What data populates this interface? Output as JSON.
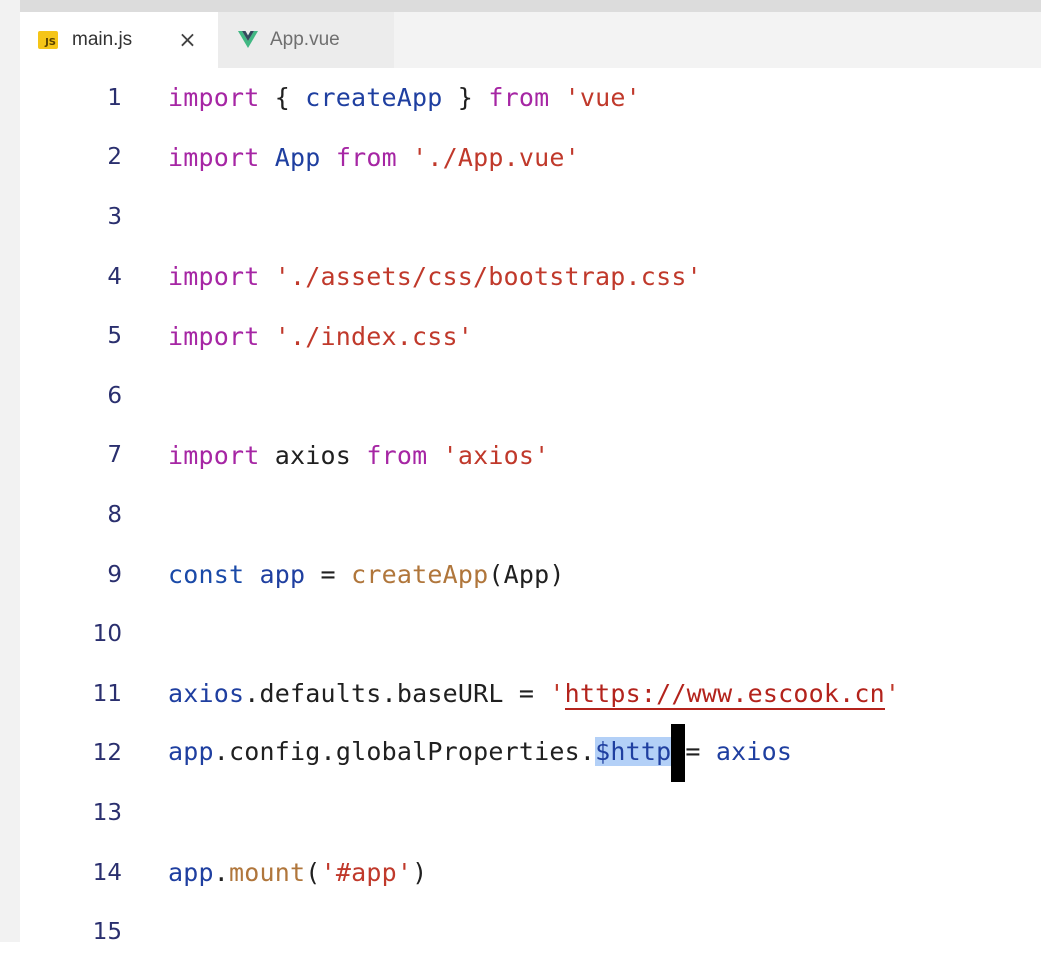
{
  "tabs": [
    {
      "label": "main.js",
      "icon": "js-file-icon",
      "icon_text": "JS",
      "active": true
    },
    {
      "label": "App.vue",
      "icon": "vue-file-icon",
      "active": false
    }
  ],
  "close_glyph": "×",
  "lines": [
    {
      "n": "1"
    },
    {
      "n": "2"
    },
    {
      "n": "3"
    },
    {
      "n": "4"
    },
    {
      "n": "5"
    },
    {
      "n": "6"
    },
    {
      "n": "7"
    },
    {
      "n": "8"
    },
    {
      "n": "9"
    },
    {
      "n": "10"
    },
    {
      "n": "11"
    },
    {
      "n": "12"
    },
    {
      "n": "13"
    },
    {
      "n": "14"
    },
    {
      "n": "15"
    }
  ],
  "code": {
    "l1": {
      "import": "import",
      "open": " { ",
      "name": "createApp",
      "close": " } ",
      "from": "from",
      "sp": " ",
      "src": "'vue'"
    },
    "l2": {
      "import": "import",
      "sp1": " ",
      "name": "App",
      "sp2": " ",
      "from": "from",
      "sp3": " ",
      "src": "'./App.vue'"
    },
    "l4": {
      "import": "import",
      "sp": " ",
      "src": "'./assets/css/bootstrap.css'"
    },
    "l5": {
      "import": "import",
      "sp": " ",
      "src": "'./index.css'"
    },
    "l7": {
      "import": "import",
      "sp1": " ",
      "name": "axios",
      "sp2": " ",
      "from": "from",
      "sp3": " ",
      "src": "'axios'"
    },
    "l9": {
      "const": "const",
      "sp1": " ",
      "name": "app",
      "eq": " = ",
      "fn": "createApp",
      "open": "(",
      "arg": "App",
      "close": ")"
    },
    "l11": {
      "obj": "axios",
      "dot1": ".",
      "p1": "defaults",
      "dot2": ".",
      "p2": "baseURL",
      "eq": " = ",
      "q1": "'",
      "url": "https://www.escook.cn",
      "q2": "'"
    },
    "l12": {
      "obj": "app",
      "dot1": ".",
      "p1": "config",
      "dot2": ".",
      "p2": "globalProperties",
      "dot3": ".",
      "sel": "$http",
      "eq": "= ",
      "val": "axios"
    },
    "l14": {
      "obj": "app",
      "dot": ".",
      "fn": "mount",
      "open": "(",
      "arg": "'#app'",
      "close": ")"
    }
  }
}
